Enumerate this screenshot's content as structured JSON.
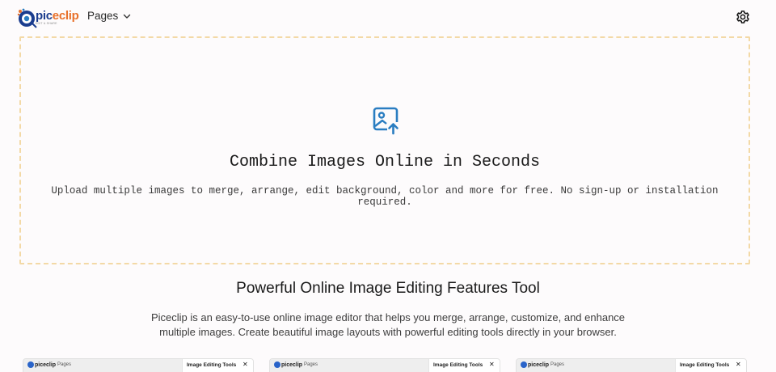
{
  "header": {
    "logo": {
      "word_pic": "pic",
      "word_clip": "eclip",
      "tagline": "EDIT & SHARE"
    },
    "nav": {
      "pages_label": "Pages"
    }
  },
  "dropzone": {
    "title": "Combine Images Online in Seconds",
    "subtitle": "Upload multiple images to merge, arrange, edit background, color and more for free. No sign-up or installation required."
  },
  "features": {
    "title": "Powerful Online Image Editing Features Tool",
    "description": "Piceclip is an easy-to-use online image editor that helps you merge, arrange, customize, and enhance multiple images. Create beautiful image layouts with powerful editing tools directly in your browser."
  },
  "cards": [
    {
      "logo": "piceclip",
      "pages_label": "Pages",
      "panel_title": "Image Editing Tools",
      "close": "✕"
    },
    {
      "logo": "piceclip",
      "pages_label": "Pages",
      "panel_title": "Image Editing Tools",
      "close": "✕"
    },
    {
      "logo": "piceclip",
      "pages_label": "Pages",
      "panel_title": "Image Editing Tools",
      "close": "✕"
    }
  ],
  "colors": {
    "accent_blue": "#2a7dc1",
    "logo_blue": "#1a3c8e",
    "logo_orange": "#e8702a",
    "dropzone_border": "#f3d9a6"
  },
  "icons": {
    "upload": "image-upload-icon",
    "settings": "gear-icon",
    "chevron": "chevron-down-icon"
  }
}
